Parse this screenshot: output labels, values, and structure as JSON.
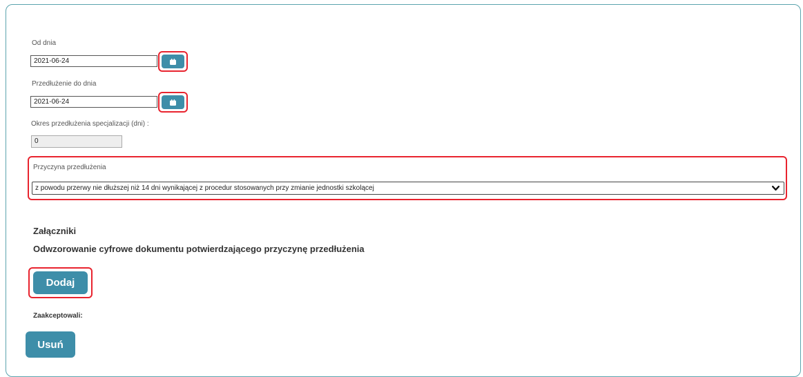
{
  "form": {
    "from_date": {
      "label": "Od dnia",
      "value": "2021-06-24",
      "button_icon": "calendar-icon"
    },
    "extend_to": {
      "label": "Przedłużenie do dnia",
      "value": "2021-06-24",
      "button_icon": "calendar-icon"
    },
    "period": {
      "label": "Okres przedłużenia specjalizacji (dni) :",
      "value": "0"
    },
    "reason": {
      "label": "Przyczyna przedłużenia",
      "selected": "z powodu przerwy nie dłuższej niż 14 dni wynikającej z procedur stosowanych przy zmianie jednostki szkolącej"
    }
  },
  "attachments": {
    "title": "Załączniki",
    "subtitle": "Odwzorowanie cyfrowe dokumentu potwierdzającego przyczynę przedłużenia",
    "add_label": "Dodaj"
  },
  "accepted": {
    "label": "Zaakceptowali:"
  },
  "delete_label": "Usuń",
  "colors": {
    "accent": "#3e8ea9",
    "highlight": "#e8232e",
    "card_border": "#5aa3ad"
  }
}
